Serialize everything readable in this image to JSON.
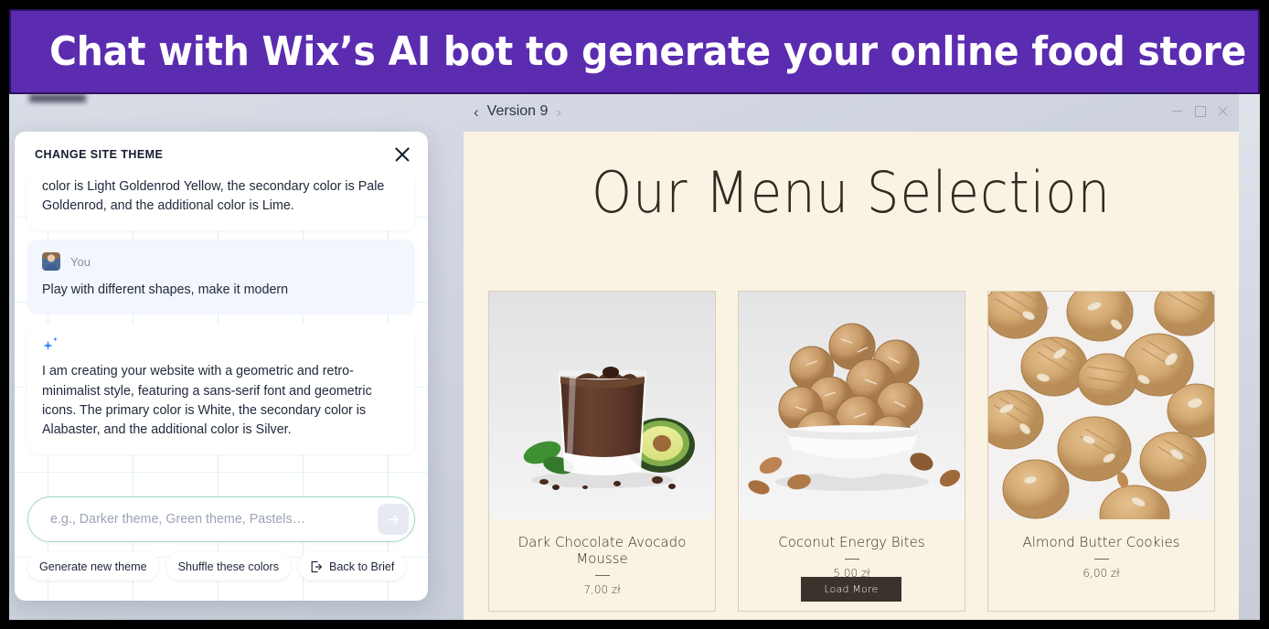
{
  "banner": {
    "title": "Chat with Wix’s AI bot to generate your online food store",
    "bg_color": "#5B2CB0",
    "text_color": "#FFFFFF"
  },
  "toolbar": {
    "prev_icon": "chevron-left-icon",
    "next_icon": "chevron-right-icon",
    "version_label": "Version 9",
    "window_controls": {
      "minimize": "minimize-icon",
      "maximize": "maximize-icon",
      "close": "close-icon"
    }
  },
  "chat_panel": {
    "title": "CHANGE SITE THEME",
    "close_icon": "close-icon",
    "messages": [
      {
        "role": "bot",
        "clipped": true,
        "text": "color is Light Goldenrod Yellow, the secondary color is Pale Goldenrod, and the additional color is Lime."
      },
      {
        "role": "user",
        "author": "You",
        "avatar_icon": "user-avatar",
        "text": "Play with different shapes, make it modern"
      },
      {
        "role": "bot",
        "icon": "ai-sparkle-icon",
        "text": "I am creating your website with a geometric and retro-minimalist style, featuring a sans-serif font and geometric icons. The primary color is White, the secondary color is Alabaster, and the additional color is Silver."
      }
    ],
    "input": {
      "placeholder": "e.g., Darker theme, Green theme, Pastels…",
      "value": "",
      "send_icon": "arrow-right-icon"
    },
    "chips": [
      {
        "label": "Generate new theme",
        "icon": null
      },
      {
        "label": "Shuffle these colors",
        "icon": null
      },
      {
        "label": "Back to Brief",
        "icon": "exit-arrow-icon"
      }
    ]
  },
  "site_preview": {
    "background_color": "#FAF3E4",
    "heading": "Our Menu Selection",
    "products": [
      {
        "name": "Dark Chocolate Avocado Mousse",
        "price": "7,00 zł",
        "image_alt": "chocolate-mousse-glass-with-avocado"
      },
      {
        "name": "Coconut Energy Bites",
        "price": "5,00 zł",
        "image_alt": "coconut-energy-bites-in-white-bowl"
      },
      {
        "name": "Almond Butter Cookies",
        "price": "6,00 zł",
        "image_alt": "almond-butter-cookies-scattered"
      }
    ],
    "load_more_label": "Load More",
    "load_more_bg": "#3A332B"
  }
}
